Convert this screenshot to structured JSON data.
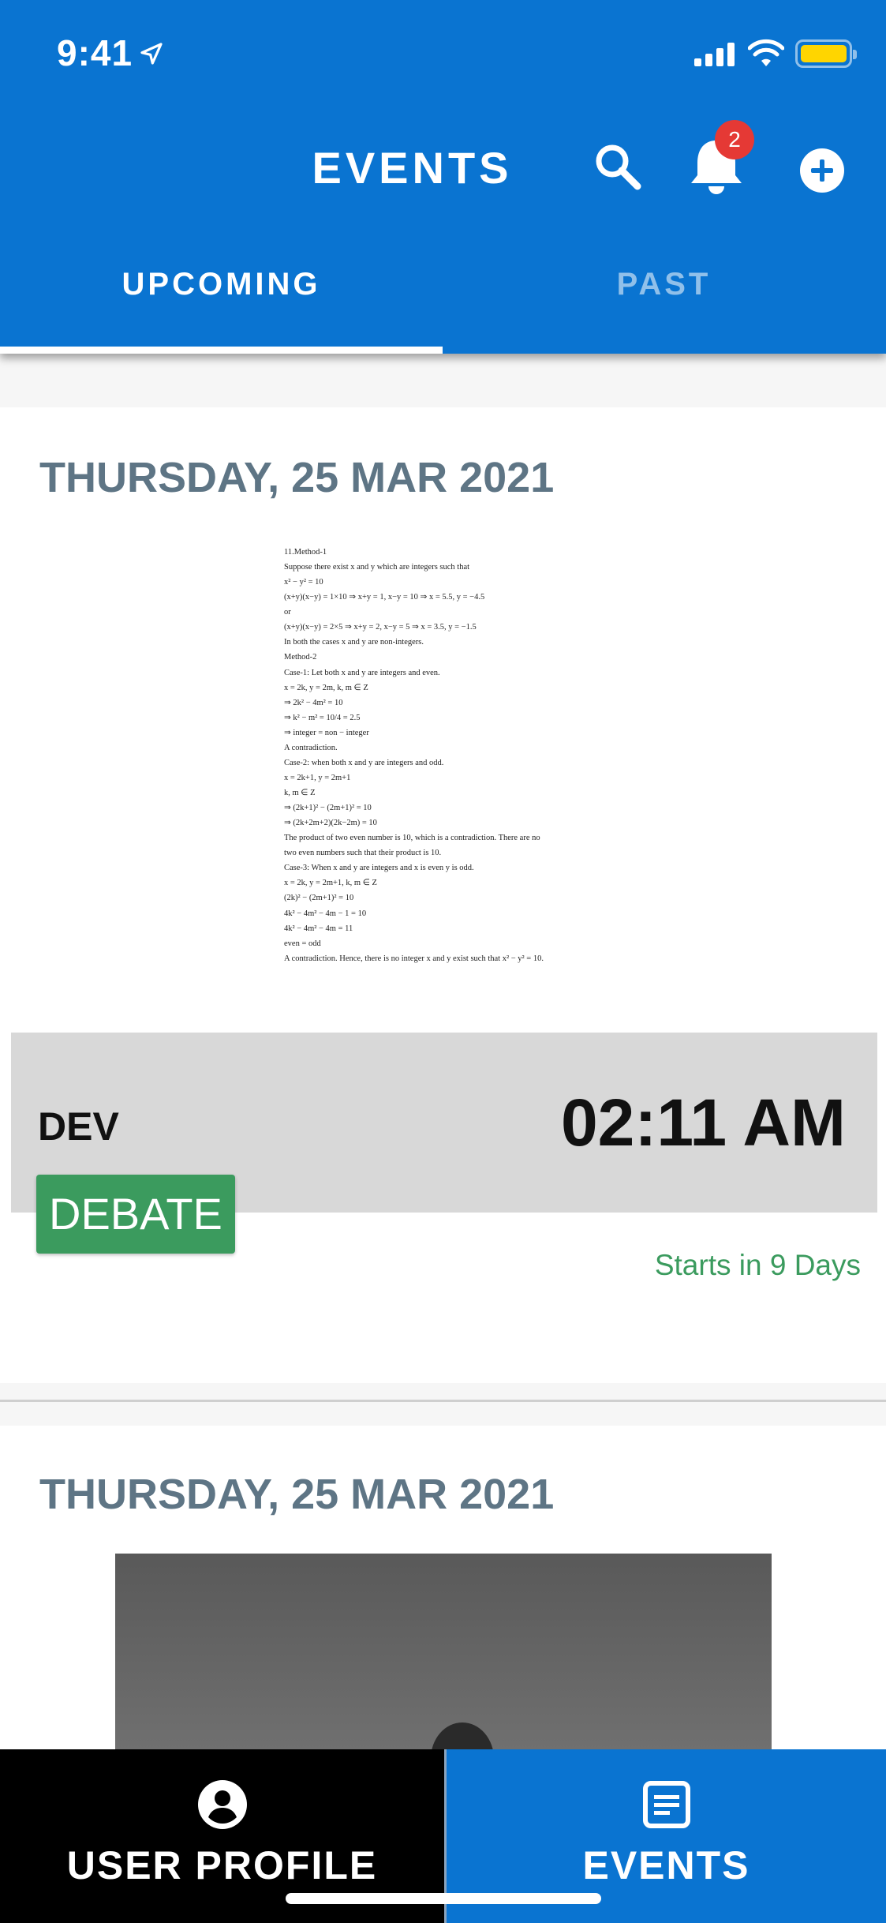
{
  "status_bar": {
    "time": "9:41"
  },
  "header": {
    "title": "EVENTS",
    "notification_count": "2",
    "icons": [
      "search-icon",
      "bell-icon",
      "add-icon"
    ]
  },
  "tabs": [
    {
      "label": "UPCOMING",
      "active": true
    },
    {
      "label": "PAST",
      "active": false
    }
  ],
  "events": [
    {
      "date": "THURSDAY, 25 MAR 2021",
      "document_lines": [
        "11.Method-1",
        "Suppose there exist x and y which are integers such that",
        "x² − y² = 10",
        "(x+y)(x−y) = 1×10 ⇒ x+y = 1, x−y = 10 ⇒ x = 5.5, y = −4.5",
        "or",
        "(x+y)(x−y) = 2×5 ⇒ x+y = 2, x−y = 5 ⇒ x = 3.5, y = −1.5",
        "In both the cases x and y are non-integers.",
        "Method-2",
        "Case-1: Let both x and y are integers and even.",
        "x = 2k, y = 2m, k, m ∈ Z",
        "⇒ 2k² − 4m² = 10",
        "⇒ k² − m² = 10/4 = 2.5",
        "⇒ integer = non − integer",
        "A contradiction.",
        "Case-2: when both x and y are integers and odd.",
        "x = 2k+1, y = 2m+1",
        "k, m ∈ Z",
        "⇒ (2k+1)² − (2m+1)² = 10",
        "⇒ (2k+2m+2)(2k−2m) = 10",
        "The product of two even number is 10, which is a contradiction. There are no",
        "two even numbers such that their product is 10.",
        "Case-3: When x and y are integers and x is even y is odd.",
        "x = 2k, y = 2m+1, k, m ∈ Z",
        "(2k)² − (2m+1)² = 10",
        "4k² − 4m² − 4m − 1 = 10",
        "4k² − 4m² − 4m = 11",
        "even = odd",
        "A contradiction. Hence, there is no integer x and y exist such that x² − y² = 10."
      ],
      "owner": "DEV",
      "time": "02:11 AM",
      "category": "DEBATE",
      "starts_in": "Starts in 9 Days"
    },
    {
      "date": "THURSDAY, 25 MAR 2021"
    }
  ],
  "bottom_nav": [
    {
      "label": "USER PROFILE",
      "icon": "user-circle-icon",
      "active": false
    },
    {
      "label": "EVENTS",
      "icon": "events-list-icon",
      "active": true
    }
  ],
  "colors": {
    "primary": "#0a74d1",
    "date_text": "#5e7585",
    "category_bg": "#3b9b5e",
    "badge": "#e53935"
  }
}
